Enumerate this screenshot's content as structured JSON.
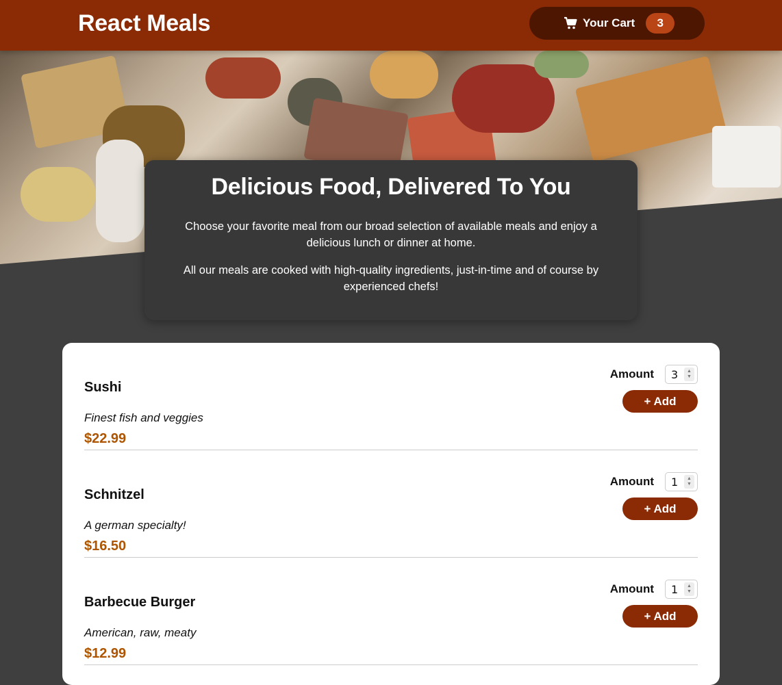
{
  "header": {
    "title": "React Meals",
    "cart_label": "Your Cart",
    "cart_count": "3"
  },
  "summary": {
    "heading": "Delicious Food, Delivered To You",
    "paragraph1": "Choose your favorite meal from our broad selection of available meals and enjoy a delicious lunch or dinner at home.",
    "paragraph2": "All our meals are cooked with high-quality ingredients, just-in-time and of course by experienced chefs!"
  },
  "meals": [
    {
      "name": "Sushi",
      "description": "Finest fish and veggies",
      "price": "$22.99",
      "amount": "3"
    },
    {
      "name": "Schnitzel",
      "description": "A german specialty!",
      "price": "$16.50",
      "amount": "1"
    },
    {
      "name": "Barbecue Burger",
      "description": "American, raw, meaty",
      "price": "$12.99",
      "amount": "1"
    }
  ],
  "labels": {
    "amount": "Amount",
    "add": "+ Add"
  },
  "colors": {
    "header": "#8a2b06",
    "cart_button": "#4d1601",
    "badge": "#b94517",
    "price": "#ad5502",
    "page_bg": "#3f3f3f",
    "summary_bg": "#383838"
  },
  "icons": {
    "cart": "cart-icon",
    "spinner": "stepper-arrows-icon"
  }
}
